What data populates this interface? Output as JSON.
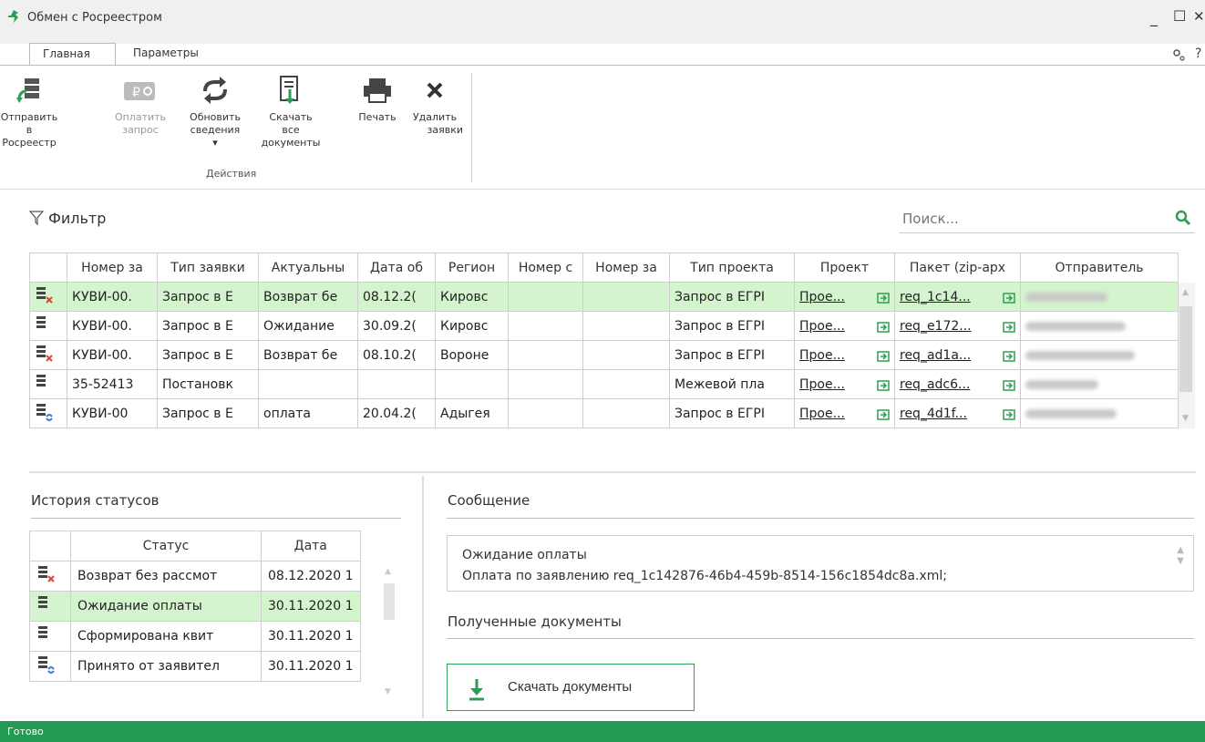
{
  "window": {
    "title": "Обмен с Росреестром",
    "minimize": "_",
    "maximize": "☐",
    "close": "✕"
  },
  "tabs": [
    "Главная",
    "Параметры"
  ],
  "ribbon": {
    "buttons": [
      {
        "label1": "Отправить в",
        "label2": "Росреестр",
        "icon": "send-icon",
        "enabled": true
      },
      {
        "label1": "Оплатить",
        "label2": "запрос",
        "icon": "payment-icon",
        "enabled": false
      },
      {
        "label1": "Обновить",
        "label2": "сведения ▾",
        "icon": "refresh-icon",
        "enabled": true
      },
      {
        "label1": "Скачать все",
        "label2": "документы",
        "icon": "download-documents-icon",
        "enabled": true
      },
      {
        "label1": "Печать",
        "label2": "",
        "icon": "printer-icon",
        "enabled": true
      },
      {
        "label1": "Удалить",
        "label2": "заявки",
        "icon": "delete-icon",
        "enabled": true
      }
    ],
    "group_label": "Действия"
  },
  "filter": {
    "label": "Фильтр"
  },
  "search": {
    "placeholder": "Поиск..."
  },
  "requests": {
    "columns": [
      "",
      "Номер за",
      "Тип заявки",
      "Актуальны",
      "Дата об",
      "Регион",
      "Номер с",
      "Номер за",
      "Тип проекта",
      "Проект",
      "Пакет (zip-арх",
      "Отправитель"
    ],
    "rows": [
      {
        "status_icon": "rejected",
        "number": "КУВИ-00.",
        "type": "Запрос в Е",
        "status": "Возврат бе",
        "date": "08.12.2(",
        "region": "Кировс",
        "num2": "",
        "num3": "",
        "project_type": "Запрос в ЕГРІ",
        "project": "Прое...",
        "package": "req_1c14...",
        "selected": true
      },
      {
        "status_icon": "plain",
        "number": "КУВИ-00.",
        "type": "Запрос в Е",
        "status": "Ожидание",
        "date": "30.09.2(",
        "region": "Кировс",
        "num2": "",
        "num3": "",
        "project_type": "Запрос в ЕГРІ",
        "project": "Прое...",
        "package": "req_e172...",
        "selected": false
      },
      {
        "status_icon": "rejected",
        "number": "КУВИ-00.",
        "type": "Запрос в Е",
        "status": "Возврат бе",
        "date": "08.10.2(",
        "region": "Вороне",
        "num2": "",
        "num3": "",
        "project_type": "Запрос в ЕГРІ",
        "project": "Прое...",
        "package": "req_ad1a...",
        "selected": false
      },
      {
        "status_icon": "plain",
        "number": "35-52413",
        "type": "Постановк",
        "status": "",
        "date": "",
        "region": "",
        "num2": "",
        "num3": "",
        "project_type": "Межевой пла",
        "project": "Прое...",
        "package": "req_adc6...",
        "selected": false
      },
      {
        "status_icon": "synced",
        "number": "КУВИ-00",
        "type": "Запрос в Е",
        "status": "оплата",
        "date": "20.04.2(",
        "region": "Адыгея",
        "num2": "",
        "num3": "",
        "project_type": "Запрос в ЕГРІ",
        "project": "Прое...",
        "package": "req_4d1f...",
        "selected": false
      }
    ]
  },
  "history": {
    "title": "История статусов",
    "columns": [
      "",
      "Статус",
      "Дата"
    ],
    "rows": [
      {
        "status_icon": "rejected",
        "status": "Возврат без рассмот",
        "date": "08.12.2020 1",
        "selected": false
      },
      {
        "status_icon": "plain",
        "status": "Ожидание оплаты",
        "date": "30.11.2020 1",
        "selected": true
      },
      {
        "status_icon": "plain",
        "status": "Сформирована квит",
        "date": "30.11.2020 1",
        "selected": false
      },
      {
        "status_icon": "synced",
        "status": "Принято от заявител",
        "date": "30.11.2020 1",
        "selected": false
      }
    ]
  },
  "message": {
    "title": "Сообщение",
    "line1": "Ожидание оплаты",
    "line2": "Оплата по заявлению req_1c142876-46b4-459b-8514-156c1854dc8a.xml;"
  },
  "documents": {
    "title": "Полученные документы",
    "download_label": "Скачать документы"
  },
  "statusbar": {
    "text": "Готово"
  },
  "colors": {
    "accent": "#239b55",
    "selected_row": "#d3f4cd"
  }
}
